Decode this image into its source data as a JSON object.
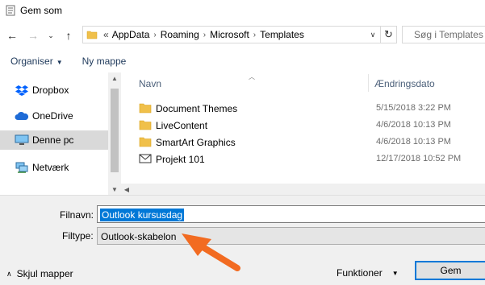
{
  "window": {
    "title": "Gem som",
    "app_icon": "notepad-icon"
  },
  "nav": {
    "back_icon": "arrow-left-icon",
    "forward_icon": "arrow-right-icon",
    "recent_icon": "chevron-down-icon",
    "up_icon": "arrow-up-icon"
  },
  "address": {
    "overflow": "«",
    "crumbs": [
      "AppData",
      "Roaming",
      "Microsoft",
      "Templates"
    ],
    "refresh_icon": "refresh-icon"
  },
  "search": {
    "placeholder": "Søg i Templates"
  },
  "toolbar": {
    "organiser": "Organiser",
    "new_folder": "Ny mappe"
  },
  "sidebar": {
    "items": [
      {
        "label": "Dropbox",
        "icon": "dropbox-icon"
      },
      {
        "label": "OneDrive",
        "icon": "cloud-icon"
      },
      {
        "label": "Denne pc",
        "icon": "computer-icon"
      },
      {
        "label": "Netværk",
        "icon": "network-icon"
      }
    ]
  },
  "files": {
    "columns": {
      "name": "Navn",
      "date": "Ændringsdato"
    },
    "rows": [
      {
        "name": "Document Themes",
        "date": "5/15/2018 3:22 PM",
        "icon": "folder-icon"
      },
      {
        "name": "LiveContent",
        "date": "4/6/2018 10:13 PM",
        "icon": "folder-icon"
      },
      {
        "name": "SmartArt Graphics",
        "date": "4/6/2018 10:13 PM",
        "icon": "folder-icon"
      },
      {
        "name": "Projekt 101",
        "date": "12/17/2018 10:52 PM",
        "icon": "envelope-icon"
      }
    ]
  },
  "form": {
    "filename_label": "Filnavn:",
    "filename_value": "Outlook kursusdag",
    "filetype_label": "Filtype:",
    "filetype_value": "Outlook-skabelon"
  },
  "footer": {
    "hide_folders": "Skjul mapper",
    "functions": "Funktioner",
    "save": "Gem"
  },
  "colors": {
    "accent": "#0078d7",
    "annotation_arrow": "#f26b21",
    "folder": "#f0c04a"
  }
}
